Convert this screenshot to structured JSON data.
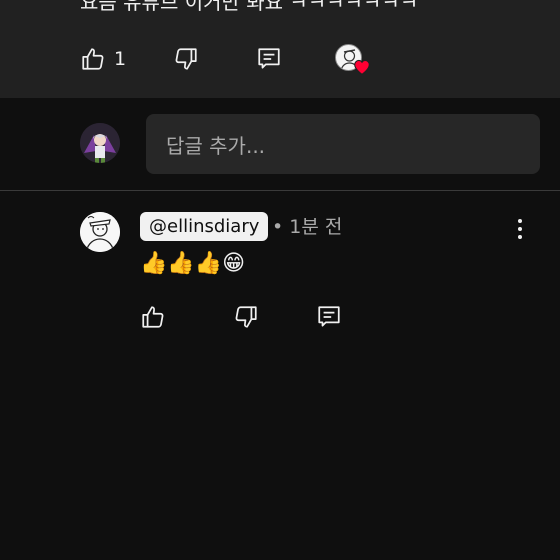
{
  "parent_comment": {
    "text": "요즘 유튜브 이거만 봐요 ㅋㅋㅋㅋㅋㅋㅋ",
    "like_count": "1"
  },
  "reply_box": {
    "placeholder": "답글 추가..."
  },
  "reply": {
    "handle": "@ellinsdiary",
    "meta": "• 1분 전",
    "text": "👍👍👍😁"
  },
  "icons": {
    "like": "thumbs-up-icon",
    "dislike": "thumbs-down-icon",
    "reply": "comment-icon",
    "heart": "heart-icon",
    "more": "more-vertical-icon"
  },
  "colors": {
    "background": "#0f0f0f",
    "panel": "#212121",
    "input": "#272727",
    "heart": "#ff0033"
  }
}
